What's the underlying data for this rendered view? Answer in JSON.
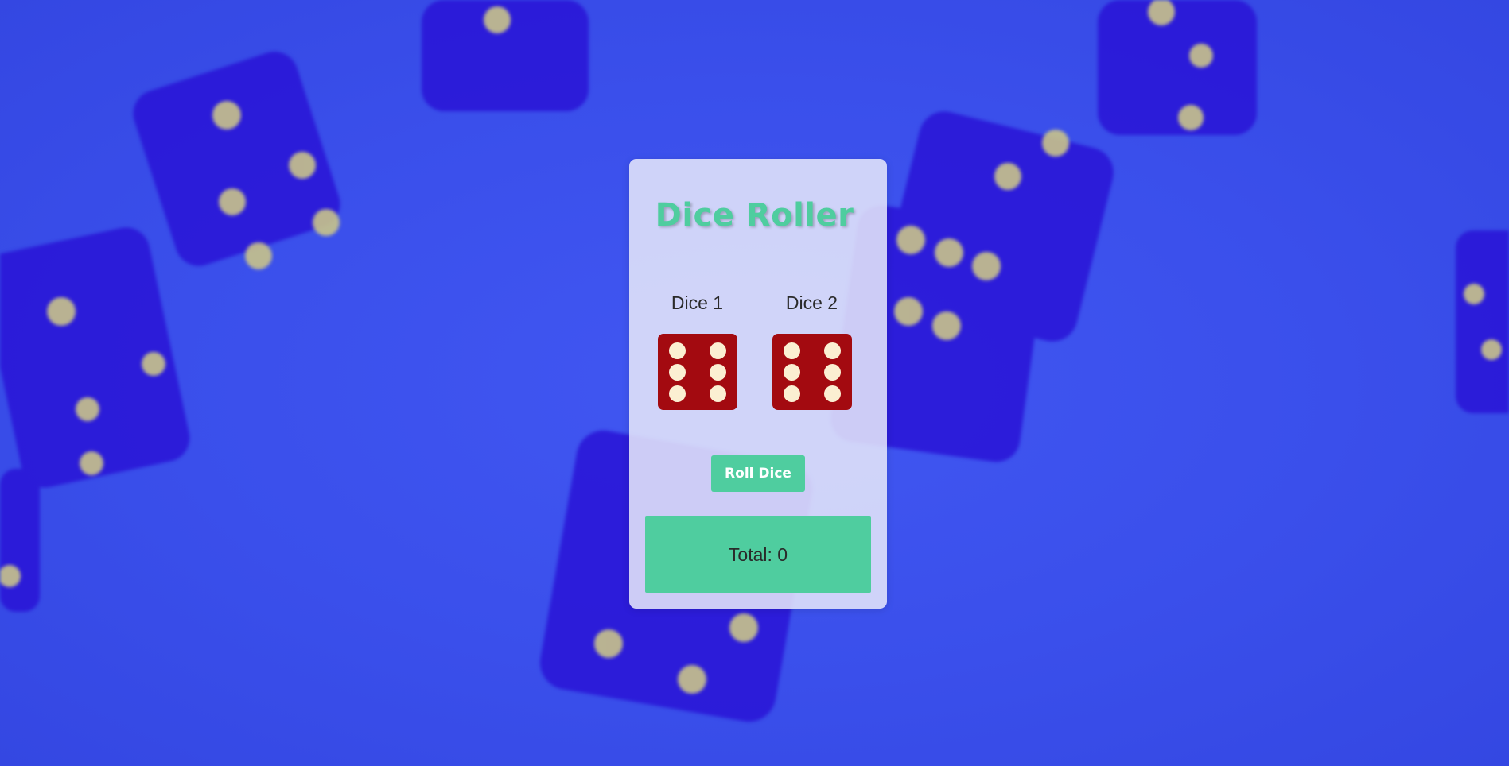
{
  "app": {
    "title": "Dice Roller"
  },
  "dice": [
    {
      "label": "Dice 1",
      "value": 6
    },
    {
      "label": "Dice 2",
      "value": 6
    }
  ],
  "roll_button": {
    "label": "Roll Dice"
  },
  "total": {
    "text": "Total: 0"
  },
  "colors": {
    "accent": "#4fcd9f",
    "die_face": "#a30a10",
    "pip": "#fbefd2",
    "background": "#3a4ff0"
  }
}
